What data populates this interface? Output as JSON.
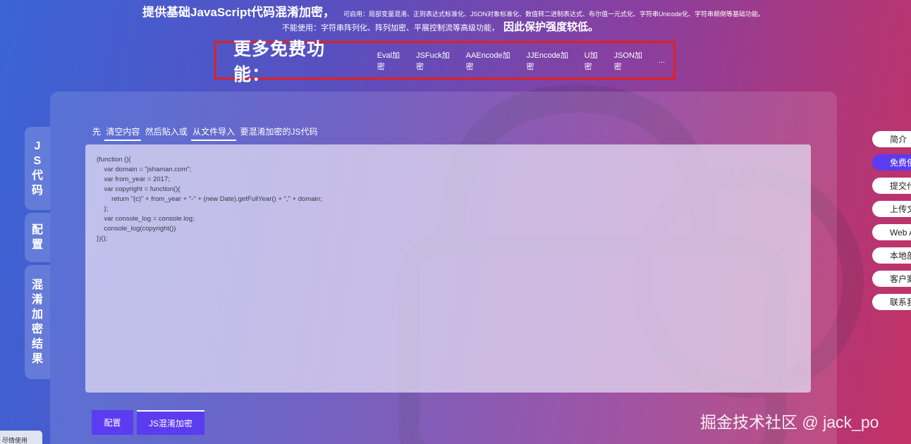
{
  "header": {
    "line1_big": "提供基础JavaScript代码混淆加密，",
    "line1_small": "可启用：局部变量混淆、正则表达式标准化、JSON对象标准化、数值转二进制表达式、布尔值一元式化、字符串Unicode化、字符串颠倒等基础功能。",
    "line2_small": "不能使用：字符串阵列化、阵列加密、平展控制流等高级功能，",
    "line2_big": "因此保护强度较低。"
  },
  "more": {
    "title": "更多免费功能：",
    "links": [
      "Eval加密",
      "JSFuck加密",
      "AAEncode加密",
      "JJEncode加密",
      "U加密",
      "JSON加密",
      "..."
    ]
  },
  "side_tabs": {
    "js_code": [
      "J",
      "S",
      "代",
      "码"
    ],
    "config": [
      "配",
      "置"
    ],
    "result": [
      "混",
      "淆",
      "加",
      "密",
      "结",
      "果"
    ]
  },
  "instruction": {
    "prefix": "先",
    "clear_link": "清空内容",
    "middle": "然后贴入或",
    "import_link": "从文件导入",
    "suffix": "要混淆加密的JS代码"
  },
  "editor": {
    "lines": [
      "(function (){",
      "    var domain = \"jshaman.com\";",
      "    var from_year = 2017;",
      "    var copyright = function(){",
      "        return \"(c)\" + from_year + \"-\" + (new Date).getFullYear() + \",\" + domain;",
      "    };",
      "    var console_log = console.log;",
      "    console_log(copyright())",
      "})();"
    ]
  },
  "buttons": {
    "config": "配置",
    "obfuscate": "JS混淆加密"
  },
  "right_nav": {
    "items": [
      "简介",
      "免费使用",
      "提交代码",
      "上传文件",
      "Web API",
      "本地部署",
      "客户案例",
      "联系我们"
    ],
    "active_index": 1
  },
  "watermark": "掘金技术社区 @ jack_po",
  "corner_tab": "尽情使用",
  "colors": {
    "accent": "#5b3cf0",
    "highlight_border": "#e02020"
  }
}
